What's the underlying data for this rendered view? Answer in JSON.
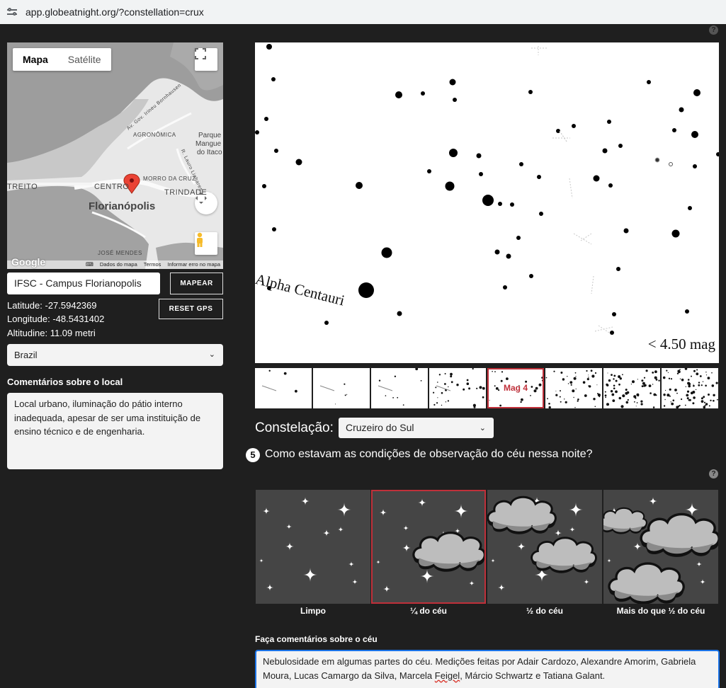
{
  "browser": {
    "url": "app.globeatnight.org/?constellation=crux"
  },
  "map": {
    "tabs": [
      "Mapa",
      "Satélite"
    ],
    "active_tab": "Mapa",
    "labels": {
      "city": "Florianópolis",
      "centro": "CENTRO",
      "trindade": "TRINDADE",
      "morro": "MORRO DA CRUZ",
      "agronomica": "AGRONÔMICA",
      "estreito": "TREITO",
      "jose_mendes": "JOSÉ MENDES",
      "road1": "Av. Gov. Irineu Bornhausen",
      "road2": "R. Lauro Linhares",
      "parque": [
        "Parque",
        "Mangue",
        "do Itaco"
      ]
    },
    "footer": [
      "Dados do mapa",
      "Termos",
      "Informar erro no mapa"
    ],
    "logo": "Google"
  },
  "location": {
    "name_value": "IFSC - Campus Florianopolis",
    "map_button": "MAPEAR",
    "reset_button": "RESET GPS",
    "latitude": "Latitude: -27.5942369",
    "longitude": "Longitude: -48.5431402",
    "altitude": "Altitudine: 11.09 metri",
    "country": "Brazil",
    "comments_label": "Comentários sobre o local",
    "comments_value": "Local urbano, iluminação do pátio interno inadequada, apesar de ser uma instituição de ensino técnico e de engenharia."
  },
  "starchart": {
    "star_label": "Alpha Centauri",
    "magnitude": "< 4.50 mag",
    "selected_thumb": "Mag 4",
    "thumb_count": 8,
    "active_index": 4
  },
  "constellation": {
    "label": "Constelação:",
    "value": "Cruzeiro do Sul"
  },
  "question": {
    "number": "5",
    "text": "Como estavam as condições de observação do céu nessa noite?",
    "help": "?",
    "options": [
      "Limpo",
      "¼ do céu",
      "½ do céu",
      "Mais do que ½ do céu"
    ],
    "selected_index": 1
  },
  "sky_comments": {
    "label": "Faça comentários sobre o céu",
    "value_part1": "Nebulosidade em algumas partes do céu. Medições feitas por Adair Cardozo, Alexandre Amorim, Gabriela Moura, Lucas Camargo da Silva, Marcela ",
    "value_misspelled": "Feigel",
    "value_part2": ", Márcio Schwartz e Tatiana Galant."
  },
  "colors": {
    "selected_border": "#c0303a",
    "focus_border": "#1a73e8",
    "background": "#1f1f1f"
  }
}
